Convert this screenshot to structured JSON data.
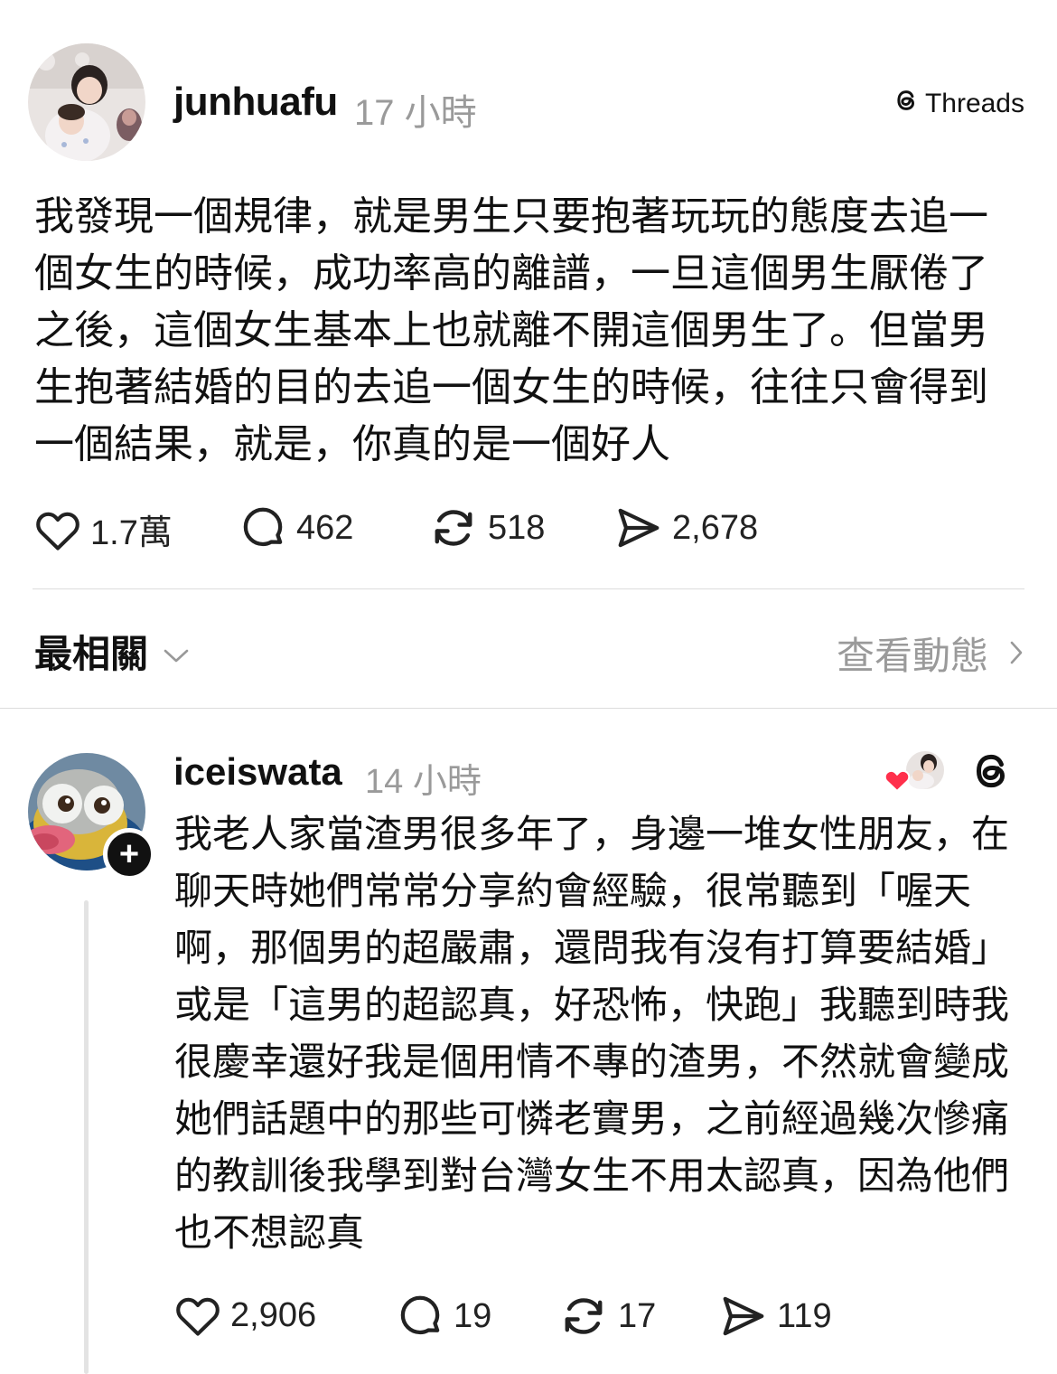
{
  "post": {
    "username": "junhuafu",
    "time": "17 小時",
    "brand": "Threads",
    "text": "我發現一個規律，就是男生只要抱著玩玩的態度去追一個女生的時候，成功率高的離譜，一旦這個男生厭倦了之後，這個女生基本上也就離不開這個男生了。但當男生抱著結婚的目的去追一個女生的時候，往往只會得到一個結果，就是，你真的是一個好人",
    "likes": "1.7萬",
    "comments": "462",
    "reposts": "518",
    "shares": "2,678"
  },
  "sort": {
    "label": "最相關",
    "activity_label": "查看動態"
  },
  "reply": {
    "username": "iceiswata",
    "time": "14 小時",
    "text": "我老人家當渣男很多年了，身邊一堆女性朋友，在聊天時她們常常分享約會經驗，很常聽到「喔天啊，那個男的超嚴肅，還問我有沒有打算要結婚」或是「這男的超認真，好恐怖，快跑」我聽到時我很慶幸還好我是個用情不專的渣男，不然就會變成她們話題中的那些可憐老實男，之前經過幾次慘痛的教訓後我學到對台灣女生不用太認真，因為他們也不想認真",
    "likes": "2,906",
    "comments": "19",
    "reposts": "17",
    "shares": "119"
  }
}
